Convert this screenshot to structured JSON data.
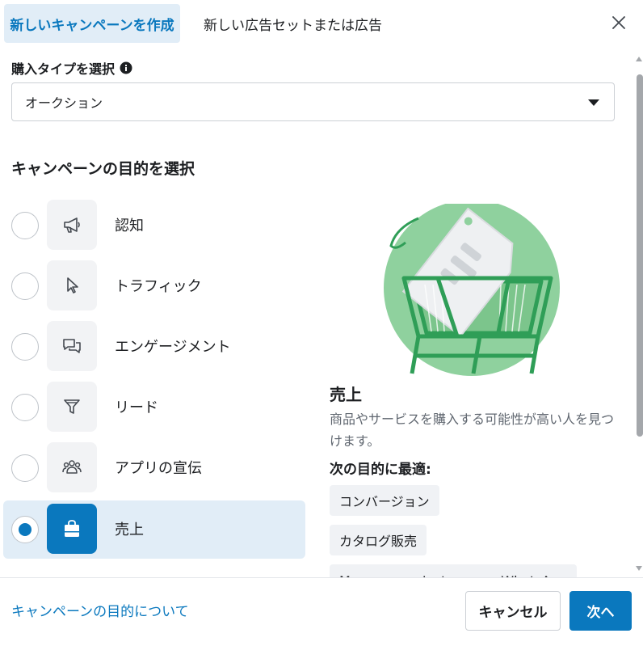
{
  "header": {
    "tab_new_campaign": "新しいキャンペーンを作成",
    "tab_new_adset": "新しい広告セットまたは広告"
  },
  "buying_type": {
    "label": "購入タイプを選択",
    "value": "オークション"
  },
  "objectives": {
    "title": "キャンペーンの目的を選択",
    "items": [
      {
        "label": "認知",
        "icon": "megaphone-icon",
        "selected": false
      },
      {
        "label": "トラフィック",
        "icon": "cursor-icon",
        "selected": false
      },
      {
        "label": "エンゲージメント",
        "icon": "chat-bubbles-icon",
        "selected": false
      },
      {
        "label": "リード",
        "icon": "filter-icon",
        "selected": false
      },
      {
        "label": "アプリの宣伝",
        "icon": "people-icon",
        "selected": false
      },
      {
        "label": "売上",
        "icon": "shopping-bag-icon",
        "selected": true
      }
    ]
  },
  "detail": {
    "title": "売上",
    "description": "商品やサービスを購入する可能性が高い人を見つけます。",
    "best_for_label": "次の目的に最適:",
    "tags": [
      "コンバージョン",
      "カタログ販売",
      "Messenger、Instagram、WhatsApp"
    ]
  },
  "footer": {
    "about_link": "キャンペーンの目的について",
    "cancel": "キャンセル",
    "next": "次へ"
  },
  "colors": {
    "accent": "#0a78be",
    "selected_bg": "#e1edf7",
    "illustration_green": "#8fd19e"
  }
}
